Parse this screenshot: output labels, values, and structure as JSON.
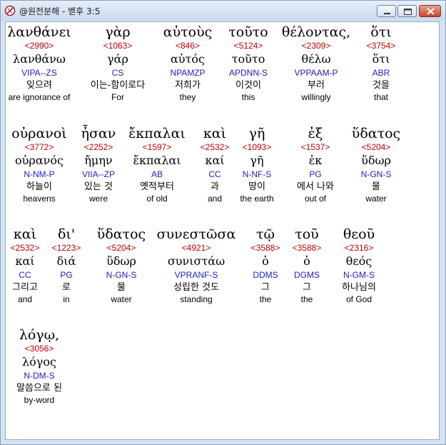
{
  "window": {
    "title": "@원전분해 - 벧후 3:5"
  },
  "words": [
    {
      "greek": "λανθάνει",
      "strong": "<2990>",
      "lemma": "λανθάνω",
      "parse": "VIPA--ZS",
      "korean": "잊으려",
      "english": "are ignorance of"
    },
    {
      "greek": "γὰρ",
      "strong": "<1063>",
      "lemma": "γάρ",
      "parse": "CS",
      "korean": "이는-함이로다",
      "english": "For"
    },
    {
      "greek": "αὐτοὺς",
      "strong": "<846>",
      "lemma": "αὐτός",
      "parse": "NPAMZP",
      "korean": "저희가",
      "english": "they"
    },
    {
      "greek": "τοῦτο",
      "strong": "<5124>",
      "lemma": "τοῦτο",
      "parse": "APDNN-S",
      "korean": "이것이",
      "english": "this"
    },
    {
      "greek": "θέλοντας,",
      "strong": "<2309>",
      "lemma": "θέλω",
      "parse": "VPPAAM-P",
      "korean": "부러",
      "english": "willingly"
    },
    {
      "greek": "ὅτι",
      "strong": "<3754>",
      "lemma": "ὅτι",
      "parse": "ABR",
      "korean": "것을",
      "english": "that"
    },
    {
      "greek": "οὐρανοὶ",
      "strong": "<3772>",
      "lemma": "οὐρανός",
      "parse": "N-NM-P",
      "korean": "하늘이",
      "english": "heavens"
    },
    {
      "greek": "ἦσαν",
      "strong": "<2252>",
      "lemma": "ἤμην",
      "parse": "VIIA--ZP",
      "korean": "있는 것",
      "english": "were"
    },
    {
      "greek": "ἔκπαλαι",
      "strong": "<1597>",
      "lemma": "ἔκπαλαι",
      "parse": "AB",
      "korean": "옛적부터",
      "english": "of old"
    },
    {
      "greek": "καὶ",
      "strong": "<2532>",
      "lemma": "καί",
      "parse": "CC",
      "korean": "과",
      "english": "and"
    },
    {
      "greek": "γῆ",
      "strong": "<1093>",
      "lemma": "γῆ",
      "parse": "N-NF-S",
      "korean": "땅이",
      "english": "the earth"
    },
    {
      "greek": "ἐξ",
      "strong": "<1537>",
      "lemma": "ἐκ",
      "parse": "PG",
      "korean": "에서 나와",
      "english": "out of"
    },
    {
      "greek": "ὕδατος",
      "strong": "<5204>",
      "lemma": "ὕδωρ",
      "parse": "N-GN-S",
      "korean": "물",
      "english": "water"
    },
    {
      "greek": "καὶ",
      "strong": "<2532>",
      "lemma": "καί",
      "parse": "CC",
      "korean": "그리고",
      "english": "and"
    },
    {
      "greek": "δι'",
      "strong": "<1223>",
      "lemma": "διά",
      "parse": "PG",
      "korean": "로",
      "english": "in"
    },
    {
      "greek": "ὕδατος",
      "strong": "<5204>",
      "lemma": "ὕδωρ",
      "parse": "N-GN-S",
      "korean": "물",
      "english": "water"
    },
    {
      "greek": "συνεστῶσα",
      "strong": "<4921>",
      "lemma": "συνιστάω",
      "parse": "VPRANF-S",
      "korean": "성립한 것도",
      "english": "standing"
    },
    {
      "greek": "τῷ",
      "strong": "<3588>",
      "lemma": "ὁ",
      "parse": "DDMS",
      "korean": "그",
      "english": "the"
    },
    {
      "greek": "τοῦ",
      "strong": "<3588>",
      "lemma": "ὁ",
      "parse": "DGMS",
      "korean": "그",
      "english": "the"
    },
    {
      "greek": "θεοῦ",
      "strong": "<2316>",
      "lemma": "θεός",
      "parse": "N-GM-S",
      "korean": "하나님의",
      "english": "of God"
    },
    {
      "greek": "λόγῳ,",
      "strong": "<3056>",
      "lemma": "λόγος",
      "parse": "N-DM-S",
      "korean": "말씀으로 된",
      "english": "by-word"
    }
  ]
}
